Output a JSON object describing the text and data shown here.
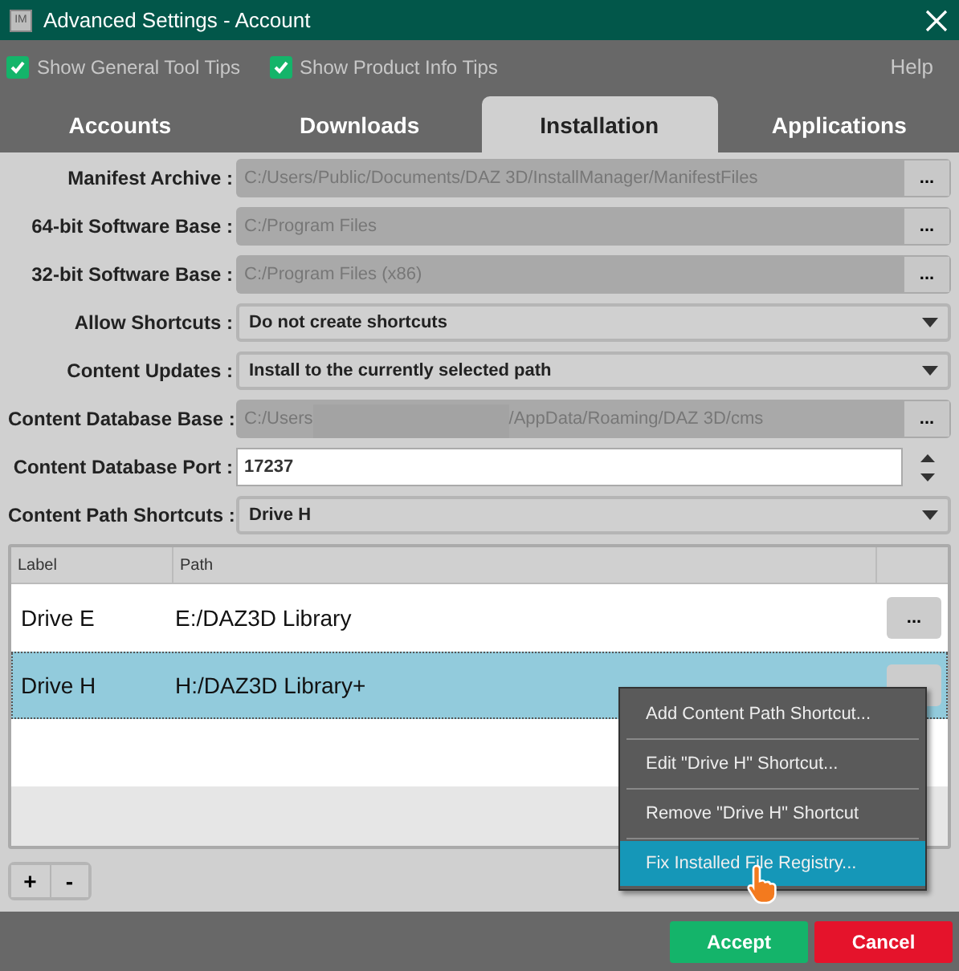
{
  "window": {
    "title": "Advanced Settings - Account",
    "app_icon": "IM"
  },
  "toolbar": {
    "options": [
      {
        "label": "Show General Tool Tips",
        "checked": true
      },
      {
        "label": "Show Product Info Tips",
        "checked": true
      }
    ],
    "help": "Help"
  },
  "tabs": [
    {
      "label": "Accounts",
      "selected": false
    },
    {
      "label": "Downloads",
      "selected": false
    },
    {
      "label": "Installation",
      "selected": true
    },
    {
      "label": "Applications",
      "selected": false
    }
  ],
  "settings": [
    {
      "label": "Manifest Archive :",
      "kind": "path",
      "value": "C:/Users/Public/Documents/DAZ 3D/InstallManager/ManifestFiles",
      "button": "..."
    },
    {
      "label": "64-bit Software Base :",
      "kind": "path",
      "value": "C:/Program Files",
      "button": "..."
    },
    {
      "label": "32-bit Software Base :",
      "kind": "path",
      "value": "C:/Program Files (x86)",
      "button": "..."
    },
    {
      "label": "Allow Shortcuts :",
      "kind": "select",
      "value": "Do not create shortcuts"
    },
    {
      "label": "Content Updates :",
      "kind": "select",
      "value": "Install to the currently selected path"
    },
    {
      "label": "Content Database Base :",
      "kind": "redacted_path",
      "value": "C:/Users",
      "value_after": "/AppData/Roaming/DAZ 3D/cms",
      "button": "..."
    },
    {
      "label": "Content Database Port :",
      "kind": "spin",
      "value": "17237"
    },
    {
      "label": "Content Path Shortcuts :",
      "kind": "select",
      "value": "Drive H"
    }
  ],
  "table": {
    "columns": [
      "Label",
      "Path"
    ],
    "rows": [
      {
        "label": "Drive E",
        "path": "E:/DAZ3D Library",
        "button": "...",
        "selected": false
      },
      {
        "label": "Drive H",
        "path": "H:/DAZ3D Library+",
        "selected": true
      }
    ]
  },
  "list_buttons": [
    "+",
    "-"
  ],
  "context_menu": {
    "items": [
      {
        "label": "Add Content Path Shortcut...",
        "selected": false
      },
      {
        "label": "Edit \"Drive H\" Shortcut...",
        "selected": false
      },
      {
        "label": "Remove \"Drive H\" Shortcut",
        "selected": false
      },
      {
        "label": "Fix Installed File Registry...",
        "selected": true
      }
    ]
  },
  "buttons": [
    {
      "label": "Accept",
      "kind": "accept"
    },
    {
      "label": "Cancel",
      "kind": "cancel"
    }
  ]
}
